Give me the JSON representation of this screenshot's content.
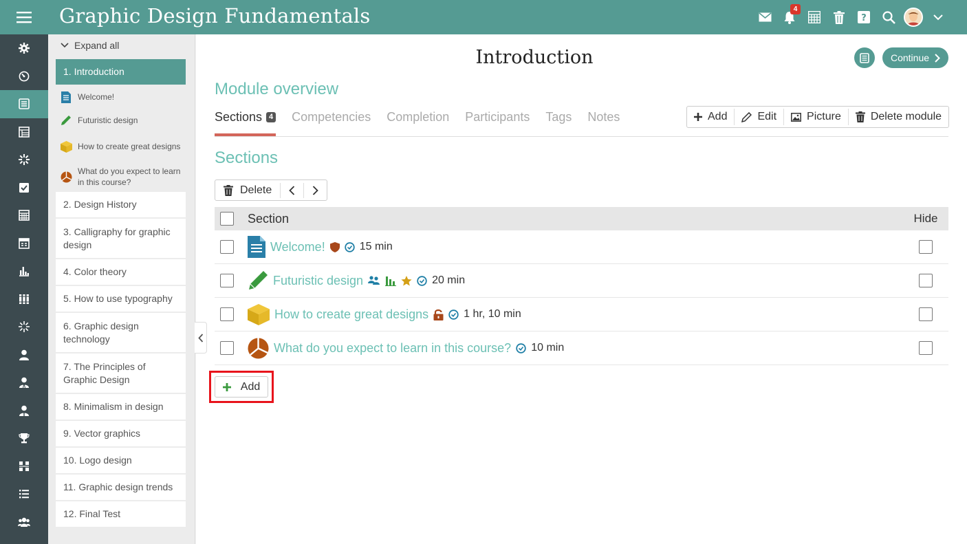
{
  "app": {
    "title": "Graphic Design Fundamentals"
  },
  "topbar": {
    "notifications_count": "4",
    "icons": [
      "mail-icon",
      "bell-icon",
      "calendar-icon",
      "trash-icon",
      "help-icon",
      "search-icon",
      "avatar",
      "chevron-down-icon"
    ]
  },
  "leftnav": {
    "items": [
      "settings-icon",
      "dashboard-icon",
      "courses-icon",
      "catalog-icon",
      "skills-icon",
      "assignments-icon",
      "calendar-icon",
      "schedule-icon",
      "reports-icon",
      "library-icon",
      "competencies-icon",
      "user-icon",
      "user-group-icon",
      "instructor-icon",
      "trophy-icon",
      "structure-icon",
      "list-icon",
      "community-icon"
    ]
  },
  "outline": {
    "expand_all": "Expand all",
    "modules": [
      {
        "label": "1. Introduction",
        "active": true
      },
      {
        "label": "2. Design History"
      },
      {
        "label": "3. Calligraphy for graphic design"
      },
      {
        "label": "4. Color theory"
      },
      {
        "label": "5. How to use typography"
      },
      {
        "label": "6. Graphic design technology"
      },
      {
        "label": "7. The Principles of Graphic Design"
      },
      {
        "label": "8. Minimalism in design"
      },
      {
        "label": "9. Vector graphics"
      },
      {
        "label": "10. Logo design"
      },
      {
        "label": "11. Graphic design trends"
      },
      {
        "label": "12. Final Test"
      }
    ],
    "subsections": [
      {
        "label": "Welcome!",
        "icon": "page-icon"
      },
      {
        "label": "Futuristic design",
        "icon": "pencil-icon"
      },
      {
        "label": "How to create great designs",
        "icon": "package-icon"
      },
      {
        "label": "What do you expect to learn in this course?",
        "icon": "survey-icon"
      }
    ]
  },
  "main": {
    "title": "Introduction",
    "continue_label": "Continue",
    "module_overview": "Module overview",
    "tabs": [
      {
        "label": "Sections",
        "count": "4",
        "active": true
      },
      {
        "label": "Competencies"
      },
      {
        "label": "Completion"
      },
      {
        "label": "Participants"
      },
      {
        "label": "Tags"
      },
      {
        "label": "Notes"
      }
    ],
    "module_actions": {
      "add": "Add",
      "edit": "Edit",
      "picture": "Picture",
      "delete": "Delete module"
    },
    "sections_heading": "Sections",
    "toolbar": {
      "delete": "Delete"
    },
    "table": {
      "col_section": "Section",
      "col_hide": "Hide",
      "rows": [
        {
          "name": "Welcome!",
          "duration": "15 min",
          "type_icon": "page-icon",
          "badges": [
            "shield-icon",
            "clock-icon"
          ]
        },
        {
          "name": "Futuristic design",
          "duration": "20 min",
          "type_icon": "pencil-icon",
          "badges": [
            "group-icon",
            "chart-icon",
            "star-icon",
            "clock-icon"
          ]
        },
        {
          "name": "How to create great designs",
          "duration": "1 hr, 10 min",
          "type_icon": "package-icon",
          "badges": [
            "lock-icon",
            "clock-icon"
          ]
        },
        {
          "name": "What do you expect to learn in this course?",
          "duration": "10 min",
          "type_icon": "survey-icon",
          "badges": [
            "clock-icon"
          ]
        }
      ]
    },
    "add_label": "Add"
  },
  "colors": {
    "teal": "#559b93",
    "link": "#6cc0b4",
    "nav_dark": "#3c4a4f",
    "tab_accent": "#d3655a",
    "highlight": "#e8141c"
  }
}
